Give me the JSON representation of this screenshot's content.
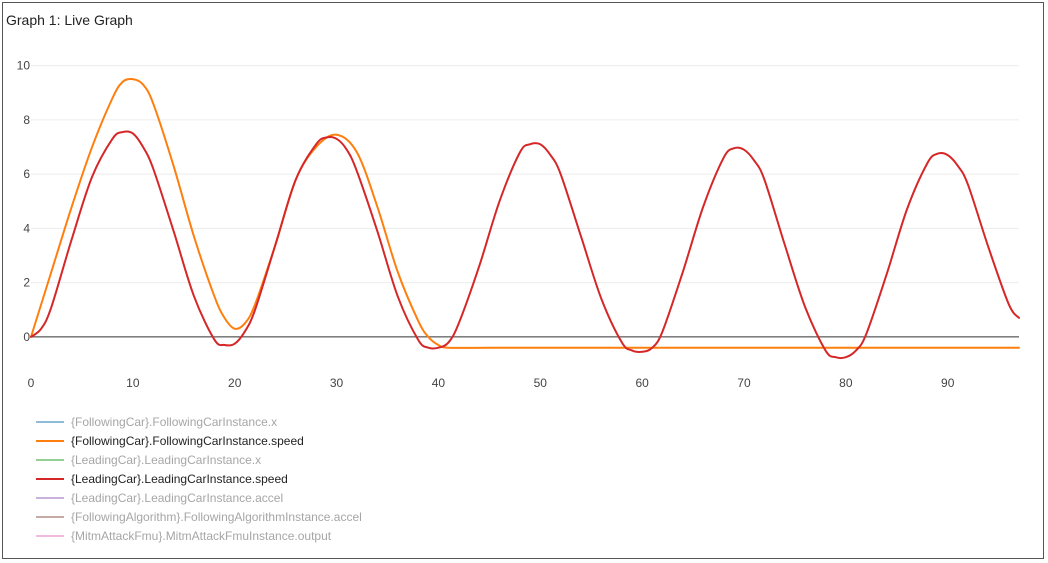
{
  "panel": {
    "title": "Graph 1: Live Graph"
  },
  "chart_data": {
    "type": "line",
    "title": "Graph 1: Live Graph",
    "xlabel": "",
    "ylabel": "",
    "xlim": [
      0,
      97
    ],
    "ylim": [
      -1,
      10.5
    ],
    "x_ticks": [
      0,
      10,
      20,
      30,
      40,
      50,
      60,
      70,
      80,
      90
    ],
    "y_ticks": [
      0,
      2,
      4,
      6,
      8,
      10
    ],
    "grid": "horizontal",
    "legend_position": "bottom-left",
    "legend": [
      {
        "name": "{FollowingCar}.FollowingCarInstance.x",
        "color": "#1f77b4",
        "active": false
      },
      {
        "name": "{FollowingCar}.FollowingCarInstance.speed",
        "color": "#ff7f0e",
        "active": true
      },
      {
        "name": "{LeadingCar}.LeadingCarInstance.x",
        "color": "#2ca02c",
        "active": false
      },
      {
        "name": "{LeadingCar}.LeadingCarInstance.speed",
        "color": "#d62728",
        "active": true
      },
      {
        "name": "{LeadingCar}.LeadingCarInstance.accel",
        "color": "#9467bd",
        "active": false
      },
      {
        "name": "{FollowingAlgorithm}.FollowingAlgorithmInstance.accel",
        "color": "#8c564b",
        "active": false
      },
      {
        "name": "{MitmAttackFmu}.MitmAttackFmuInstance.output",
        "color": "#e377c2",
        "active": false
      }
    ],
    "series": [
      {
        "name": "{FollowingCar}.FollowingCarInstance.speed",
        "color": "#ff7f0e",
        "x": [
          0,
          2,
          4,
          6,
          8,
          9,
          10,
          11,
          12,
          14,
          16,
          18,
          19,
          20,
          21,
          22,
          24,
          26,
          28,
          30,
          32,
          34,
          36,
          38,
          39,
          40,
          41,
          45,
          50,
          60,
          70,
          80,
          90,
          97
        ],
        "y": [
          0,
          2.4,
          4.8,
          7.0,
          8.8,
          9.4,
          9.5,
          9.3,
          8.6,
          6.3,
          3.7,
          1.5,
          0.7,
          0.3,
          0.5,
          1.2,
          3.4,
          5.8,
          7.0,
          7.45,
          6.8,
          4.8,
          2.4,
          0.6,
          0.0,
          -0.3,
          -0.4,
          -0.4,
          -0.4,
          -0.4,
          -0.4,
          -0.4,
          -0.4,
          -0.4
        ]
      },
      {
        "name": "{LeadingCar}.LeadingCarInstance.speed",
        "color": "#d62728",
        "x": [
          0,
          1,
          2,
          4,
          6,
          8,
          9,
          10,
          11,
          12,
          14,
          16,
          18,
          19,
          20,
          21,
          22,
          24,
          26,
          28,
          29,
          30,
          31,
          32,
          34,
          36,
          38,
          39,
          40,
          41,
          42,
          44,
          46,
          48,
          49,
          50,
          51,
          52,
          54,
          56,
          58,
          59,
          60,
          61,
          62,
          64,
          66,
          68,
          69,
          70,
          71,
          72,
          74,
          76,
          78,
          79,
          80,
          81,
          82,
          84,
          86,
          88,
          89,
          90,
          91,
          92,
          94,
          96,
          97
        ],
        "y": [
          0,
          0.3,
          1.1,
          3.6,
          5.9,
          7.3,
          7.55,
          7.5,
          7.0,
          6.2,
          3.9,
          1.5,
          -0.1,
          -0.3,
          -0.25,
          0.2,
          1.0,
          3.4,
          5.8,
          7.1,
          7.35,
          7.3,
          6.9,
          6.1,
          3.9,
          1.5,
          -0.1,
          -0.4,
          -0.4,
          -0.2,
          0.5,
          2.6,
          5.0,
          6.8,
          7.1,
          7.1,
          6.7,
          6.0,
          3.7,
          1.4,
          -0.2,
          -0.5,
          -0.55,
          -0.4,
          0.2,
          2.4,
          4.8,
          6.6,
          6.95,
          6.9,
          6.5,
          5.8,
          3.4,
          1.1,
          -0.5,
          -0.75,
          -0.75,
          -0.5,
          0.1,
          2.3,
          4.7,
          6.4,
          6.75,
          6.7,
          6.3,
          5.6,
          3.3,
          1.2,
          0.7
        ]
      }
    ]
  }
}
